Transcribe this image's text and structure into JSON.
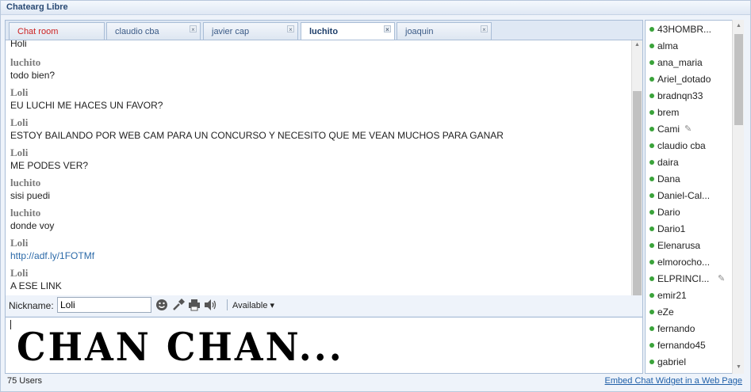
{
  "window": {
    "title": "Chatearg Libre"
  },
  "tabs": [
    {
      "label": "Chat room",
      "closable": false
    },
    {
      "label": "claudio cba",
      "closable": true
    },
    {
      "label": "javier cap",
      "closable": true
    },
    {
      "label": "luchito",
      "closable": true,
      "active": true
    },
    {
      "label": "joaquin",
      "closable": true
    }
  ],
  "tab_close_glyph": "×",
  "messages": [
    {
      "name": "",
      "text": "Holi"
    },
    {
      "name": "luchito",
      "text": "todo bien?"
    },
    {
      "name": "Loli",
      "text": "EU LUCHI ME HACES UN FAVOR?"
    },
    {
      "name": "Loli",
      "text": "ESTOY BAILANDO POR WEB CAM PARA UN CONCURSO Y NECESITO QUE ME VEAN MUCHOS PARA GANAR"
    },
    {
      "name": "Loli",
      "text": "ME PODES VER?"
    },
    {
      "name": "luchito",
      "text": "sisi puedi"
    },
    {
      "name": "luchito",
      "text": "donde voy"
    },
    {
      "name": "Loli",
      "text": "http://adf.ly/1FOTMf",
      "is_link": true
    },
    {
      "name": "Loli",
      "text": "A ESE LINK"
    }
  ],
  "toolbar": {
    "nickname_label": "Nickname:",
    "nickname_value": "Loli",
    "status": "Available",
    "status_arrow": "▾",
    "icons": [
      "smiley-icon",
      "brush-icon",
      "print-icon",
      "sound-icon"
    ]
  },
  "input": {
    "text": "CHAN CHAN..."
  },
  "footer": {
    "users_count": "75 Users",
    "embed_link": "Embed Chat Widget in a Web Page"
  },
  "users": [
    {
      "name": "43HOMBR..."
    },
    {
      "name": "alma"
    },
    {
      "name": "ana_maria"
    },
    {
      "name": "Ariel_dotado"
    },
    {
      "name": "bradnqn33"
    },
    {
      "name": "brem"
    },
    {
      "name": "Cami",
      "pencil": true
    },
    {
      "name": "claudio cba"
    },
    {
      "name": "daira"
    },
    {
      "name": "Dana"
    },
    {
      "name": "Daniel-Cal..."
    },
    {
      "name": "Dario"
    },
    {
      "name": "Dario1"
    },
    {
      "name": "Elenarusa"
    },
    {
      "name": "elmorocho..."
    },
    {
      "name": "ELPRINCI...",
      "pencil": true
    },
    {
      "name": "emir21"
    },
    {
      "name": "eZe"
    },
    {
      "name": "fernando"
    },
    {
      "name": "fernando45"
    },
    {
      "name": "gabriel"
    }
  ],
  "colors": {
    "online_dot": "#3aa33a",
    "chat_room_tab": "#cc2222",
    "link": "#2c6aa8",
    "accent": "#2a4a74"
  }
}
